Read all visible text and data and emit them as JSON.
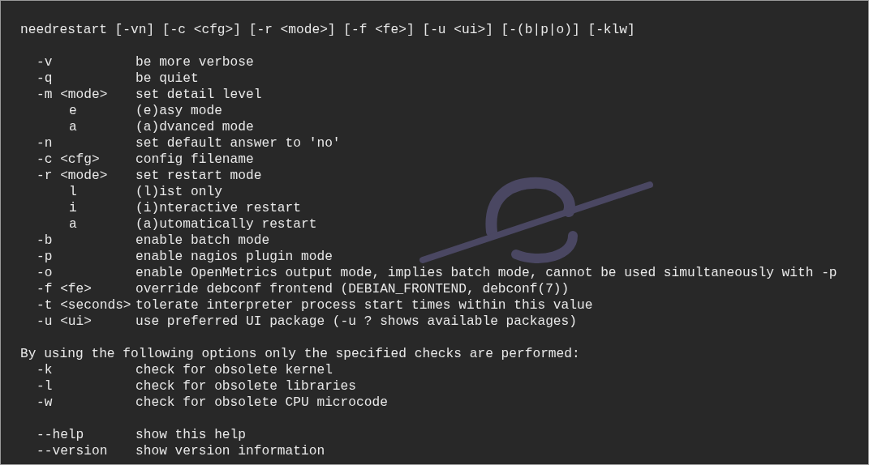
{
  "usage": "needrestart [-vn] [-c <cfg>] [-r <mode>] [-f <fe>] [-u <ui>] [-(b|p|o)] [-klw]",
  "options": [
    {
      "flag": "-v",
      "description": "be more verbose"
    },
    {
      "flag": "-q",
      "description": "be quiet"
    },
    {
      "flag": "-m <mode>",
      "description": "set detail level",
      "children": [
        {
          "flag": "e",
          "description": "(e)asy mode"
        },
        {
          "flag": "a",
          "description": "(a)dvanced mode"
        }
      ]
    },
    {
      "flag": "-n",
      "description": "set default answer to 'no'"
    },
    {
      "flag": "-c <cfg>",
      "description": "config filename"
    },
    {
      "flag": "-r <mode>",
      "description": "set restart mode",
      "children": [
        {
          "flag": "l",
          "description": "(l)ist only"
        },
        {
          "flag": "i",
          "description": "(i)nteractive restart"
        },
        {
          "flag": "a",
          "description": "(a)utomatically restart"
        }
      ]
    },
    {
      "flag": "-b",
      "description": "enable batch mode"
    },
    {
      "flag": "-p",
      "description": "enable nagios plugin mode"
    },
    {
      "flag": "-o",
      "description": "enable OpenMetrics output mode, implies batch mode, cannot be used simultaneously with -p"
    },
    {
      "flag": "-f <fe>",
      "description": "override debconf frontend (DEBIAN_FRONTEND, debconf(7))"
    },
    {
      "flag": "-t <seconds>",
      "description": "tolerate interpreter process start times within this value"
    },
    {
      "flag": "-u <ui>",
      "description": "use preferred UI package (-u ? shows available packages)"
    }
  ],
  "checks_heading": "By using the following options only the specified checks are performed:",
  "checks": [
    {
      "flag": "-k",
      "description": "check for obsolete kernel"
    },
    {
      "flag": "-l",
      "description": "check for obsolete libraries"
    },
    {
      "flag": "-w",
      "description": "check for obsolete CPU microcode"
    }
  ],
  "help_options": [
    {
      "flag": "--help",
      "description": "show this help"
    },
    {
      "flag": "--version",
      "description": "show version information"
    }
  ]
}
